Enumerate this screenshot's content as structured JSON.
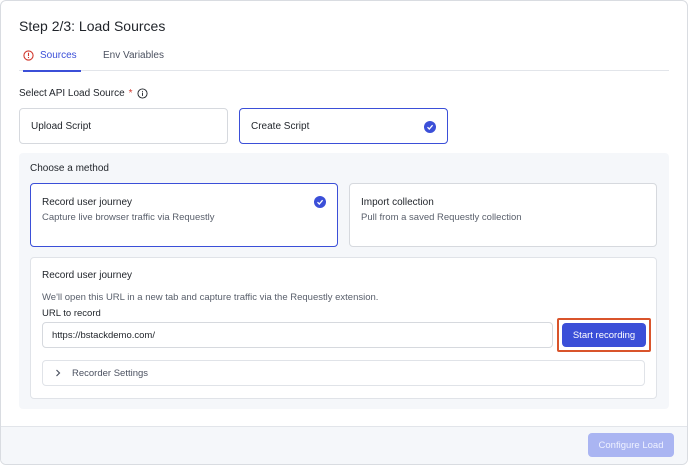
{
  "page": {
    "title": "Step 2/3: Load Sources"
  },
  "tabs": [
    {
      "label": "Sources",
      "active": true,
      "icon": "warning-icon"
    },
    {
      "label": "Env Variables",
      "active": false
    }
  ],
  "source": {
    "label": "Select API Load Source",
    "required_mark": "*",
    "options": [
      {
        "label": "Upload Script",
        "selected": false
      },
      {
        "label": "Create Script",
        "selected": true
      }
    ]
  },
  "method": {
    "title": "Choose a method",
    "cards": [
      {
        "title": "Record user journey",
        "subtitle": "Capture live browser traffic via Requestly",
        "selected": true
      },
      {
        "title": "Import collection",
        "subtitle": "Pull from a saved Requestly collection",
        "selected": false
      }
    ]
  },
  "record": {
    "heading": "Record user journey",
    "description": "We'll open this URL in a new tab and capture traffic via the Requestly extension.",
    "url_label": "URL to record",
    "url_value": "https://bstackdemo.com/",
    "start_label": "Start recording",
    "settings_label": "Recorder Settings"
  },
  "footer": {
    "configure_label": "Configure Load"
  },
  "colors": {
    "accent": "#3b4fd8",
    "highlight": "#d9542b",
    "warning": "#d1362b",
    "disabled": "#aab5f2"
  }
}
